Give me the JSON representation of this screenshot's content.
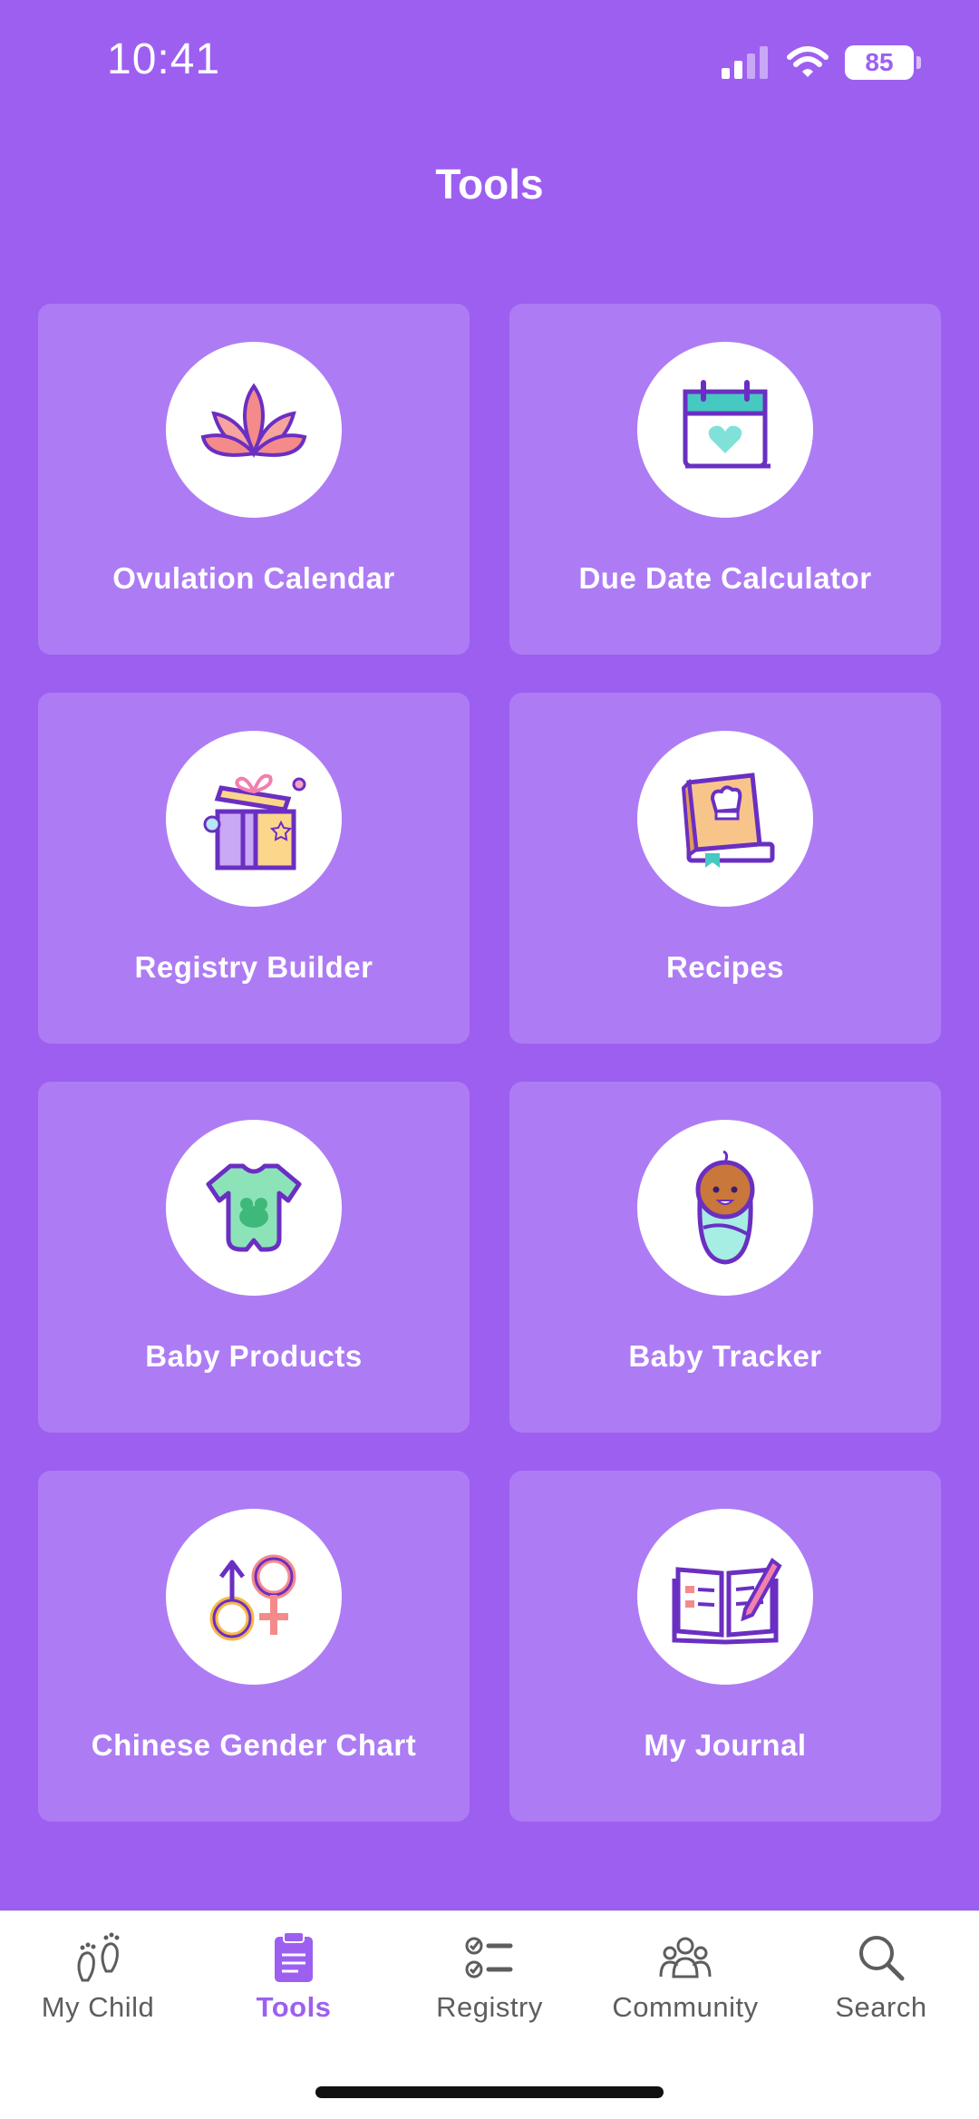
{
  "status": {
    "time": "10:41",
    "battery": "85"
  },
  "page": {
    "title": "Tools"
  },
  "tools": [
    {
      "label": "Ovulation Calendar",
      "icon": "lotus-icon"
    },
    {
      "label": "Due Date Calculator",
      "icon": "calendar-heart-icon"
    },
    {
      "label": "Registry Builder",
      "icon": "gift-box-icon"
    },
    {
      "label": "Recipes",
      "icon": "cookbook-icon"
    },
    {
      "label": "Baby Products",
      "icon": "onesie-icon"
    },
    {
      "label": "Baby Tracker",
      "icon": "swaddled-baby-icon"
    },
    {
      "label": "Chinese Gender Chart",
      "icon": "gender-symbols-icon"
    },
    {
      "label": "My Journal",
      "icon": "journal-icon"
    }
  ],
  "tabs": [
    {
      "label": "My Child",
      "icon": "footprints-icon",
      "active": false
    },
    {
      "label": "Tools",
      "icon": "clipboard-icon",
      "active": true
    },
    {
      "label": "Registry",
      "icon": "checklist-icon",
      "active": false
    },
    {
      "label": "Community",
      "icon": "people-icon",
      "active": false
    },
    {
      "label": "Search",
      "icon": "search-icon",
      "active": false
    }
  ],
  "colors": {
    "background": "#9d5ff0",
    "tile": "#ad7cf4",
    "accent": "#9d5ff0"
  }
}
